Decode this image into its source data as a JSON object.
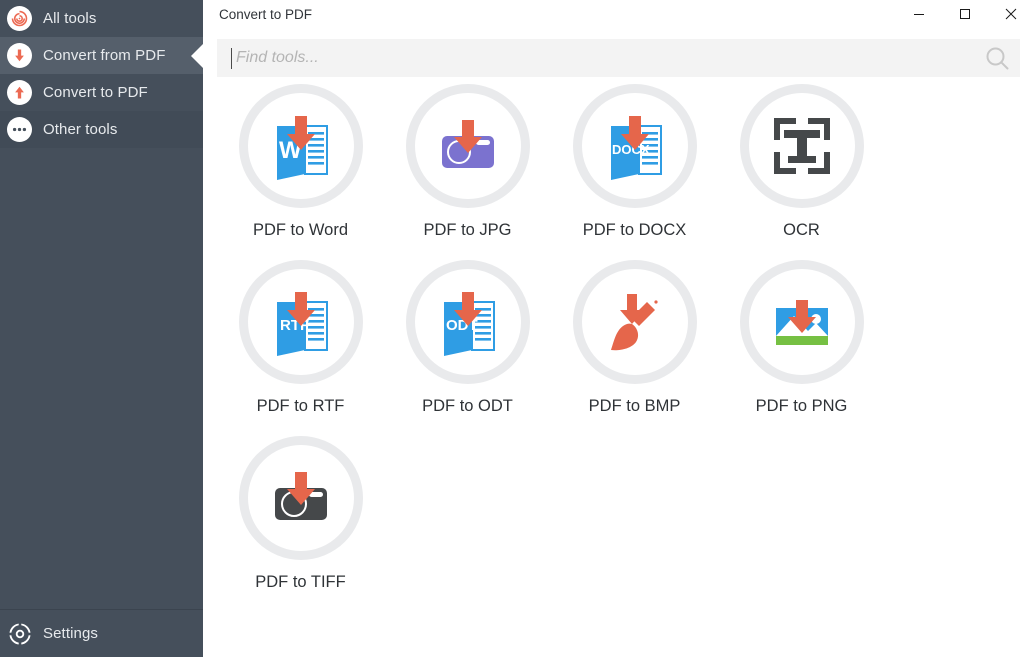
{
  "window": {
    "title": "Convert to PDF",
    "controls": [
      {
        "name": "minimize",
        "glyph": "minimize-icon"
      },
      {
        "name": "maximize",
        "glyph": "maximize-icon"
      },
      {
        "name": "close",
        "glyph": "close-icon"
      }
    ]
  },
  "sidebar": {
    "background": "#454f5b",
    "active_background": "#555f6b",
    "accent": "#ec6a53",
    "items": [
      {
        "label": "All tools",
        "icon": "spiral-target-icon",
        "active": false
      },
      {
        "label": "Convert from PDF",
        "icon": "arrow-down-circle-icon",
        "active": true
      },
      {
        "label": "Convert to PDF",
        "icon": "arrow-up-circle-icon",
        "active": false
      },
      {
        "label": "Other tools",
        "icon": "ellipsis-circle-icon",
        "active": false
      }
    ],
    "bottom": {
      "label": "Settings",
      "icon": "gear-icon"
    }
  },
  "search": {
    "placeholder": "Find tools...",
    "value": "",
    "icon": "search-icon"
  },
  "tools": [
    {
      "label": "PDF to Word",
      "icon": "pdf-to-word-icon",
      "color": "#2f9de4"
    },
    {
      "label": "PDF to JPG",
      "icon": "pdf-to-jpg-icon",
      "color": "#7b72cf"
    },
    {
      "label": "PDF to DOCX",
      "icon": "pdf-to-docx-icon",
      "color": "#2f9de4"
    },
    {
      "label": "OCR",
      "icon": "ocr-icon",
      "color": "#45484a"
    },
    {
      "label": "PDF to RTF",
      "icon": "pdf-to-rtf-icon",
      "color": "#2f9de4"
    },
    {
      "label": "PDF to ODT",
      "icon": "pdf-to-odt-icon",
      "color": "#2f9de4"
    },
    {
      "label": "PDF to BMP",
      "icon": "pdf-to-bmp-icon",
      "color": "#e5664b"
    },
    {
      "label": "PDF to PNG",
      "icon": "pdf-to-png-icon",
      "color": "#2f9de4"
    },
    {
      "label": "PDF to TIFF",
      "icon": "pdf-to-tiff-icon",
      "color": "#45484a"
    }
  ],
  "colors": {
    "arrow_red": "#e5664b",
    "blue": "#2f9de4",
    "purple": "#7b72cf",
    "dark_gray": "#45484a",
    "green": "#76c043",
    "disc_gray": "#e9eaec"
  }
}
